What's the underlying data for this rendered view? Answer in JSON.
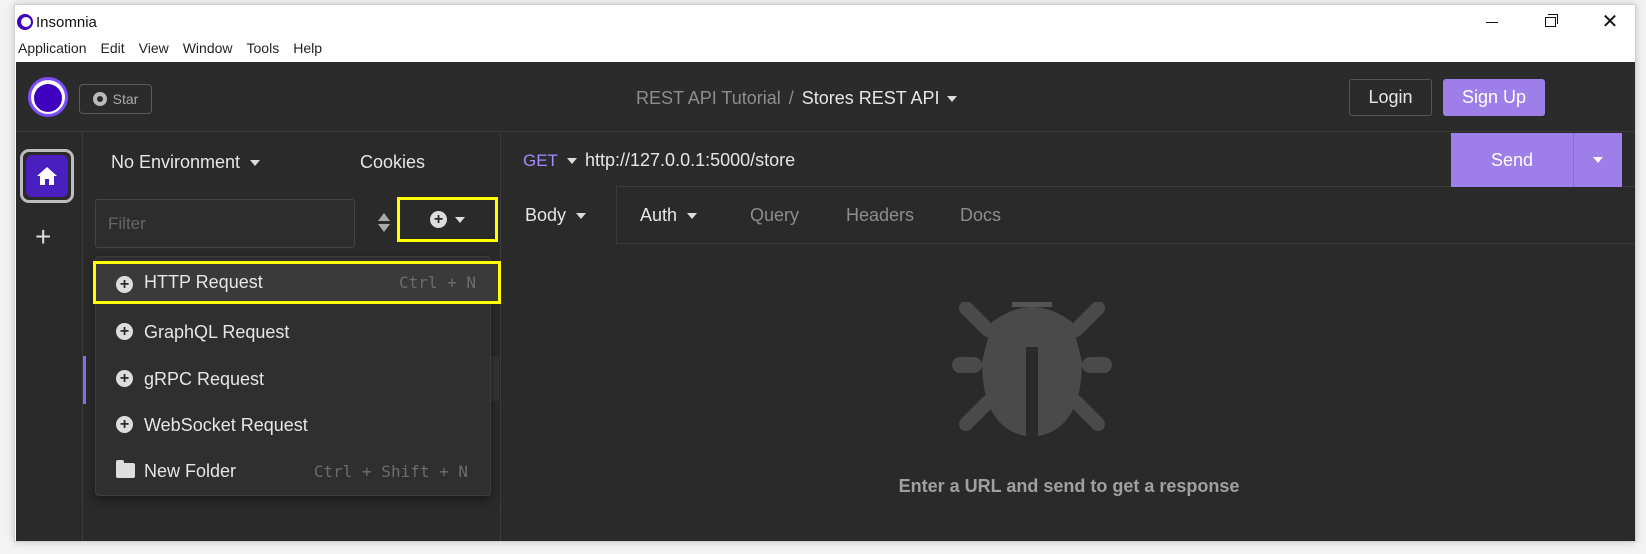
{
  "window": {
    "title": "Insomnia",
    "controls": {
      "minimize": "minimize-icon",
      "maximize": "restore-icon",
      "close": "✕"
    }
  },
  "menubar": [
    "Application",
    "Edit",
    "View",
    "Window",
    "Tools",
    "Help"
  ],
  "topbar": {
    "star_label": "Star",
    "breadcrumb": {
      "project": "REST API Tutorial",
      "separator": "/",
      "collection": "Stores REST API"
    },
    "login_label": "Login",
    "signup_label": "Sign Up"
  },
  "rail": {
    "add_symbol": "+"
  },
  "sidebar": {
    "environment": "No Environment",
    "cookies": "Cookies",
    "filter_placeholder": "Filter"
  },
  "dropdown": {
    "items": [
      {
        "label": "HTTP Request",
        "shortcut": "Ctrl + N",
        "icon": "plus-circle-icon"
      },
      {
        "label": "GraphQL Request",
        "shortcut": "",
        "icon": "plus-circle-icon"
      },
      {
        "label": "gRPC Request",
        "shortcut": "",
        "icon": "plus-circle-icon"
      },
      {
        "label": "WebSocket Request",
        "shortcut": "",
        "icon": "plus-circle-icon"
      },
      {
        "label": "New Folder",
        "shortcut": "Ctrl + Shift + N",
        "icon": "folder-icon"
      }
    ]
  },
  "request": {
    "method": "GET",
    "url": "http://127.0.0.1:5000/store",
    "send_label": "Send",
    "tabs": [
      "Body",
      "Auth",
      "Query",
      "Headers",
      "Docs"
    ],
    "empty_hint": "Enter a URL and send to get a response"
  },
  "colors": {
    "accent": "#9e7ee8",
    "highlight": "#ffff00",
    "background": "#2a2a2a"
  }
}
